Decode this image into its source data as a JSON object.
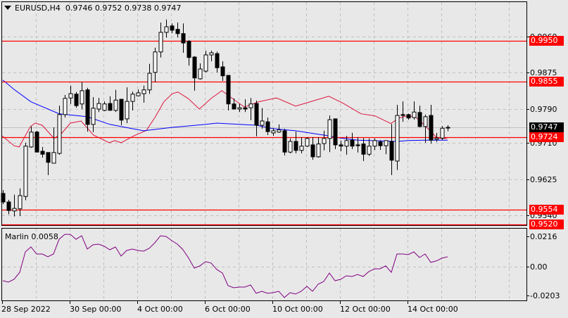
{
  "header": {
    "symbol": "EURUSD,H4",
    "ohlc": "0.9746 0.9752 0.9738 0.9747"
  },
  "indicator": {
    "title": "Marlin 0.0058"
  },
  "colors": {
    "background": "#e8e8e8",
    "level": "#ff0000",
    "ma_slow": "#0000ff",
    "ma_fast": "#dc143c",
    "marlin": "#800080",
    "grid": "#c0c0c0"
  },
  "chart_data": [
    {
      "type": "candlestick",
      "title": "EURUSD,H4",
      "ylim": [
        0.9505,
        1.001
      ],
      "y_ticks": [
        "0.9960",
        "0.9875",
        "0.9790",
        "0.9710",
        "0.9625",
        "0.9540"
      ],
      "x_ticks": [
        {
          "label": "28 Sep 2022",
          "index": 0
        },
        {
          "label": "30 Sep 00:00",
          "index": 12
        },
        {
          "label": "4 Oct 00:00",
          "index": 24
        },
        {
          "label": "6 Oct 00:00",
          "index": 36
        },
        {
          "label": "10 Oct 00:00",
          "index": 48
        },
        {
          "label": "12 Oct 00:00",
          "index": 60
        },
        {
          "label": "14 Oct 00:00",
          "index": 72
        }
      ],
      "current_price": "0.9747",
      "levels": [
        "0.9950",
        "0.9855",
        "0.9724",
        "0.9554",
        "0.9520"
      ],
      "ohlc": [
        [
          0.9592,
          0.96,
          0.9567,
          0.9572
        ],
        [
          0.9572,
          0.9577,
          0.9543,
          0.9552
        ],
        [
          0.9551,
          0.9589,
          0.9538,
          0.9557
        ],
        [
          0.9556,
          0.9604,
          0.9539,
          0.9587
        ],
        [
          0.9585,
          0.9711,
          0.9576,
          0.9703
        ],
        [
          0.9701,
          0.9749,
          0.9699,
          0.9736
        ],
        [
          0.9736,
          0.9739,
          0.9689,
          0.9689
        ],
        [
          0.9691,
          0.9701,
          0.9676,
          0.9684
        ],
        [
          0.9688,
          0.9688,
          0.9635,
          0.9665
        ],
        [
          0.9663,
          0.9747,
          0.9663,
          0.9688
        ],
        [
          0.9686,
          0.9798,
          0.9683,
          0.9777
        ],
        [
          0.9777,
          0.9823,
          0.977,
          0.9815
        ],
        [
          0.9816,
          0.9845,
          0.9802,
          0.9826
        ],
        [
          0.9825,
          0.983,
          0.9793,
          0.9798
        ],
        [
          0.9802,
          0.9854,
          0.979,
          0.9833
        ],
        [
          0.9835,
          0.984,
          0.9737,
          0.9754
        ],
        [
          0.9754,
          0.9818,
          0.9736,
          0.9792
        ],
        [
          0.979,
          0.9816,
          0.9783,
          0.9803
        ],
        [
          0.9787,
          0.9808,
          0.9785,
          0.9802
        ],
        [
          0.9803,
          0.982,
          0.9787,
          0.9787
        ],
        [
          0.9787,
          0.9835,
          0.9783,
          0.9811
        ],
        [
          0.9813,
          0.9813,
          0.9752,
          0.9764
        ],
        [
          0.9767,
          0.9841,
          0.9757,
          0.9808
        ],
        [
          0.9808,
          0.9831,
          0.9787,
          0.9825
        ],
        [
          0.9821,
          0.9836,
          0.982,
          0.9828
        ],
        [
          0.9826,
          0.9845,
          0.9805,
          0.9835
        ],
        [
          0.9835,
          0.9896,
          0.9826,
          0.9874
        ],
        [
          0.9876,
          0.9934,
          0.9853,
          0.9924
        ],
        [
          0.9924,
          0.9993,
          0.9911,
          0.997
        ],
        [
          0.997,
          1.0,
          0.9958,
          0.9983
        ],
        [
          0.9985,
          0.9991,
          0.9968,
          0.9975
        ],
        [
          0.9977,
          0.9993,
          0.9958,
          0.9967
        ],
        [
          0.9967,
          0.9991,
          0.9922,
          0.9945
        ],
        [
          0.9949,
          0.9952,
          0.9892,
          0.9911
        ],
        [
          0.9912,
          0.9914,
          0.9833,
          0.9863
        ],
        [
          0.9861,
          0.9897,
          0.9859,
          0.9884
        ],
        [
          0.9879,
          0.9927,
          0.9876,
          0.9917
        ],
        [
          0.9917,
          0.9927,
          0.9902,
          0.9922
        ],
        [
          0.992,
          0.9925,
          0.9876,
          0.9887
        ],
        [
          0.9889,
          0.9902,
          0.9856,
          0.9868
        ],
        [
          0.9869,
          0.9869,
          0.9787,
          0.9802
        ],
        [
          0.9802,
          0.9815,
          0.979,
          0.979
        ],
        [
          0.979,
          0.9802,
          0.9783,
          0.9793
        ],
        [
          0.9793,
          0.9813,
          0.9783,
          0.979
        ],
        [
          0.9793,
          0.9816,
          0.9764,
          0.9802
        ],
        [
          0.9803,
          0.981,
          0.9726,
          0.9752
        ],
        [
          0.9752,
          0.9792,
          0.9744,
          0.9762
        ],
        [
          0.976,
          0.977,
          0.9729,
          0.9737
        ],
        [
          0.9734,
          0.9745,
          0.9727,
          0.9739
        ],
        [
          0.9736,
          0.9754,
          0.9734,
          0.9741
        ],
        [
          0.9739,
          0.9744,
          0.9681,
          0.9689
        ],
        [
          0.9689,
          0.9721,
          0.9686,
          0.9714
        ],
        [
          0.9714,
          0.9737,
          0.9686,
          0.9693
        ],
        [
          0.9693,
          0.9724,
          0.9686,
          0.9703
        ],
        [
          0.9703,
          0.9724,
          0.9701,
          0.9721
        ],
        [
          0.9706,
          0.9724,
          0.9671,
          0.9678
        ],
        [
          0.9678,
          0.9724,
          0.9676,
          0.9708
        ],
        [
          0.9709,
          0.9739,
          0.9693,
          0.9721
        ],
        [
          0.9721,
          0.9775,
          0.9689,
          0.9765
        ],
        [
          0.9767,
          0.9767,
          0.9696,
          0.9706
        ],
        [
          0.9706,
          0.9716,
          0.9691,
          0.9703
        ],
        [
          0.9703,
          0.9727,
          0.9683,
          0.9716
        ],
        [
          0.9717,
          0.9734,
          0.9696,
          0.9703
        ],
        [
          0.9706,
          0.9724,
          0.9688,
          0.9704
        ],
        [
          0.9708,
          0.9722,
          0.9668,
          0.9684
        ],
        [
          0.9684,
          0.9721,
          0.968,
          0.9703
        ],
        [
          0.9703,
          0.9721,
          0.9694,
          0.9716
        ],
        [
          0.9713,
          0.9717,
          0.9694,
          0.9704
        ],
        [
          0.9704,
          0.9716,
          0.9684,
          0.9716
        ],
        [
          0.9714,
          0.9755,
          0.9635,
          0.967
        ],
        [
          0.9668,
          0.98,
          0.9647,
          0.9775
        ],
        [
          0.9777,
          0.9808,
          0.976,
          0.9775
        ],
        [
          0.9777,
          0.9779,
          0.9765,
          0.9769
        ],
        [
          0.977,
          0.9808,
          0.9765,
          0.9783
        ],
        [
          0.9782,
          0.9798,
          0.9747,
          0.9749
        ],
        [
          0.9749,
          0.9777,
          0.9711,
          0.9772
        ],
        [
          0.9775,
          0.98,
          0.9709,
          0.9717
        ],
        [
          0.9719,
          0.9734,
          0.9713,
          0.9722
        ],
        [
          0.9722,
          0.975,
          0.9717,
          0.9745
        ],
        [
          0.9746,
          0.9752,
          0.9738,
          0.9747
        ]
      ],
      "ma_slow": [
        [
          0,
          0.9858
        ],
        [
          2,
          0.9836
        ],
        [
          5,
          0.9807
        ],
        [
          10,
          0.9779
        ],
        [
          15,
          0.9772
        ],
        [
          19,
          0.9754
        ],
        [
          23,
          0.9744
        ],
        [
          25,
          0.9739
        ],
        [
          30,
          0.9747
        ],
        [
          36,
          0.9754
        ],
        [
          38,
          0.9757
        ],
        [
          42,
          0.9754
        ],
        [
          45,
          0.9752
        ],
        [
          48,
          0.9744
        ],
        [
          52,
          0.9739
        ],
        [
          58,
          0.9727
        ],
        [
          60,
          0.9722
        ],
        [
          63,
          0.9717
        ],
        [
          70,
          0.9714
        ],
        [
          72,
          0.9716
        ],
        [
          75,
          0.9717
        ],
        [
          79,
          0.9717
        ]
      ],
      "ma_fast": [
        [
          -0.1,
          0.9727
        ],
        [
          2,
          0.9704
        ],
        [
          2.9,
          0.9701
        ],
        [
          4.9,
          0.9749
        ],
        [
          5.75,
          0.9757
        ],
        [
          7,
          0.9752
        ],
        [
          9.1,
          0.9721
        ],
        [
          10.4,
          0.9732
        ],
        [
          12,
          0.9757
        ],
        [
          13.9,
          0.9762
        ],
        [
          16.1,
          0.9729
        ],
        [
          18.9,
          0.9711
        ],
        [
          19.9,
          0.9716
        ],
        [
          21,
          0.9711
        ],
        [
          23.25,
          0.9727
        ],
        [
          25.5,
          0.974
        ],
        [
          27,
          0.977
        ],
        [
          28.6,
          0.9807
        ],
        [
          30.1,
          0.9826
        ],
        [
          31.1,
          0.983
        ],
        [
          32.9,
          0.9815
        ],
        [
          34.9,
          0.979
        ],
        [
          37,
          0.9815
        ],
        [
          38.9,
          0.9833
        ],
        [
          40.75,
          0.9815
        ],
        [
          42.9,
          0.9795
        ],
        [
          45.4,
          0.9807
        ],
        [
          48.6,
          0.9816
        ],
        [
          52,
          0.9797
        ],
        [
          54.1,
          0.9805
        ],
        [
          57.9,
          0.982
        ],
        [
          60.5,
          0.9803
        ],
        [
          63.6,
          0.9779
        ],
        [
          66.1,
          0.9774
        ],
        [
          68.9,
          0.9756
        ],
        [
          70.4,
          0.9769
        ],
        [
          72,
          0.9775
        ],
        [
          73.5,
          0.9769
        ],
        [
          74.9,
          0.9752
        ],
        [
          77,
          0.9724
        ],
        [
          77.9,
          0.9721
        ],
        [
          78.9,
          0.9721
        ]
      ]
    },
    {
      "type": "line",
      "title": "Marlin 0.0058",
      "ylim": [
        -0.0235,
        0.024
      ],
      "y_ticks": [
        "0.0216",
        "0.00",
        "-0.0203"
      ],
      "values": [
        -0.0099,
        -0.0109,
        -0.0089,
        -0.0039,
        0.0107,
        0.0142,
        0.0092,
        0.0092,
        0.0072,
        0.0092,
        0.0197,
        0.0232,
        0.0232,
        0.0197,
        0.0222,
        0.0127,
        0.0157,
        0.0162,
        0.0147,
        0.0122,
        0.0142,
        0.0077,
        0.0117,
        0.0127,
        0.0117,
        0.0112,
        0.0132,
        0.0172,
        0.0222,
        0.0217,
        0.0187,
        0.0162,
        0.0122,
        0.0062,
        -0.0009,
        0.0007,
        0.0037,
        0.0027,
        -0.0019,
        -0.0044,
        -0.0134,
        -0.0149,
        -0.0144,
        -0.0144,
        -0.0129,
        -0.0189,
        -0.0174,
        -0.0189,
        -0.0184,
        -0.0174,
        -0.0219,
        -0.0184,
        -0.0194,
        -0.0174,
        -0.0139,
        -0.0174,
        -0.0124,
        -0.0104,
        -0.0044,
        -0.0099,
        -0.0089,
        -0.0064,
        -0.0069,
        -0.0054,
        -0.0069,
        -0.0034,
        -0.0014,
        -0.0014,
        0.0007,
        -0.0039,
        0.0092,
        0.0092,
        0.0087,
        0.0107,
        0.0067,
        0.0092,
        0.0032,
        0.0042,
        0.0062,
        0.0072
      ]
    }
  ]
}
